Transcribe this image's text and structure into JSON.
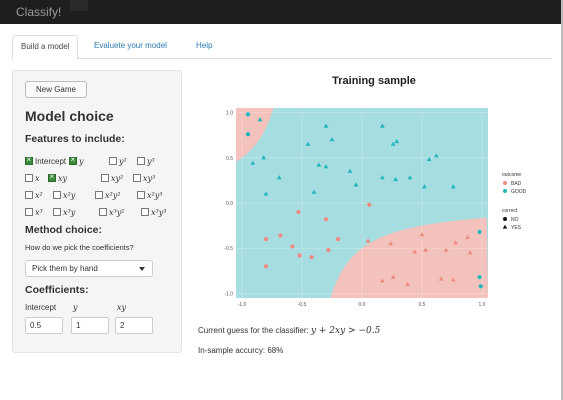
{
  "app": {
    "title": "Classify!"
  },
  "tabs": [
    "Build a model",
    "Evaluete your model",
    "Help"
  ],
  "sidebar": {
    "new_game": "New Game",
    "model_choice": "Model choice",
    "features_title": "Features to include:",
    "features": [
      {
        "label": "Intercept",
        "checked": true
      },
      {
        "label": "y",
        "checked": true
      },
      {
        "label": "y²",
        "checked": false
      },
      {
        "label": "y³",
        "checked": false
      },
      {
        "label": "x",
        "checked": false
      },
      {
        "label": "xy",
        "checked": true
      },
      {
        "label": "xy²",
        "checked": false
      },
      {
        "label": "xy³",
        "checked": false
      },
      {
        "label": "x²",
        "checked": false
      },
      {
        "label": "x²y",
        "checked": false
      },
      {
        "label": "x²y²",
        "checked": false
      },
      {
        "label": "x²y³",
        "checked": false
      },
      {
        "label": "x³",
        "checked": false
      },
      {
        "label": "x³y",
        "checked": false
      },
      {
        "label": "x³y²",
        "checked": false
      },
      {
        "label": "x³y³",
        "checked": false
      }
    ],
    "method_title": "Method choice:",
    "method_question": "How do we pick the coefficients?",
    "method_value": "Pick them by hand",
    "coef_title": "Coefficients:",
    "coefficients": [
      {
        "label": "Intercept",
        "value": "0.5"
      },
      {
        "label": "y",
        "value": "1"
      },
      {
        "label": "xy",
        "value": "2"
      }
    ]
  },
  "plot": {
    "title": "Training sample",
    "guess_prefix": "Current guess for the classifier:",
    "guess_formula": "y + 2xy > −0.5",
    "accuracy": "In-sample accurcy: 68%"
  },
  "chart_data": {
    "type": "scatter",
    "title": "Training sample",
    "xlim": [
      -1.0,
      1.0
    ],
    "ylim": [
      -1.0,
      1.0
    ],
    "xticks": [
      "-1.0",
      "-0.5",
      "0.0",
      "0.5",
      "1.0"
    ],
    "yticks": [
      "1.0",
      "0.5",
      "0.0",
      "-0.5",
      "-1.0"
    ],
    "colors": {
      "BAD": "#f08a80",
      "GOOD": "#22b6bf",
      "bad_region": "#f3c2bc",
      "good_region": "#a6dde1",
      "panel": "#e8e8e8"
    },
    "legend": {
      "outcome_title": "outcome",
      "outcome": [
        "BAD",
        "GOOD"
      ],
      "correct_title": "correct",
      "correct": [
        "NO",
        "YES"
      ]
    },
    "points": [
      {
        "x": -0.95,
        "y": 0.98,
        "outcome": "GOOD",
        "correct": "NO"
      },
      {
        "x": -0.95,
        "y": 0.76,
        "outcome": "GOOD",
        "correct": "NO"
      },
      {
        "x": -0.85,
        "y": 0.92,
        "outcome": "GOOD",
        "correct": "YES"
      },
      {
        "x": -0.82,
        "y": 0.5,
        "outcome": "GOOD",
        "correct": "YES"
      },
      {
        "x": -0.91,
        "y": 0.44,
        "outcome": "GOOD",
        "correct": "YES"
      },
      {
        "x": -0.8,
        "y": 0.1,
        "outcome": "GOOD",
        "correct": "YES"
      },
      {
        "x": -0.69,
        "y": 0.28,
        "outcome": "GOOD",
        "correct": "YES"
      },
      {
        "x": -0.45,
        "y": 0.65,
        "outcome": "GOOD",
        "correct": "YES"
      },
      {
        "x": -0.3,
        "y": 0.85,
        "outcome": "GOOD",
        "correct": "YES"
      },
      {
        "x": -0.25,
        "y": 0.7,
        "outcome": "GOOD",
        "correct": "YES"
      },
      {
        "x": -0.36,
        "y": 0.42,
        "outcome": "GOOD",
        "correct": "YES"
      },
      {
        "x": -0.3,
        "y": 0.4,
        "outcome": "GOOD",
        "correct": "YES"
      },
      {
        "x": -0.1,
        "y": 0.35,
        "outcome": "GOOD",
        "correct": "YES"
      },
      {
        "x": -0.4,
        "y": 0.12,
        "outcome": "GOOD",
        "correct": "YES"
      },
      {
        "x": -0.05,
        "y": 0.2,
        "outcome": "GOOD",
        "correct": "YES"
      },
      {
        "x": 0.17,
        "y": 0.85,
        "outcome": "GOOD",
        "correct": "YES"
      },
      {
        "x": 0.26,
        "y": 0.65,
        "outcome": "GOOD",
        "correct": "YES"
      },
      {
        "x": 0.29,
        "y": 0.68,
        "outcome": "GOOD",
        "correct": "YES"
      },
      {
        "x": 0.28,
        "y": 0.26,
        "outcome": "GOOD",
        "correct": "YES"
      },
      {
        "x": 0.4,
        "y": 0.28,
        "outcome": "GOOD",
        "correct": "YES"
      },
      {
        "x": 0.56,
        "y": 0.48,
        "outcome": "GOOD",
        "correct": "YES"
      },
      {
        "x": 0.62,
        "y": 0.52,
        "outcome": "GOOD",
        "correct": "YES"
      },
      {
        "x": 0.52,
        "y": 0.18,
        "outcome": "GOOD",
        "correct": "YES"
      },
      {
        "x": 0.76,
        "y": 0.18,
        "outcome": "GOOD",
        "correct": "YES"
      },
      {
        "x": 0.17,
        "y": 0.28,
        "outcome": "GOOD",
        "correct": "YES"
      },
      {
        "x": 0.98,
        "y": -0.32,
        "outcome": "GOOD",
        "correct": "NO"
      },
      {
        "x": 0.98,
        "y": -0.82,
        "outcome": "GOOD",
        "correct": "NO"
      },
      {
        "x": 0.99,
        "y": -0.92,
        "outcome": "GOOD",
        "correct": "NO"
      },
      {
        "x": -0.8,
        "y": -0.4,
        "outcome": "BAD",
        "correct": "NO"
      },
      {
        "x": -0.68,
        "y": -0.36,
        "outcome": "BAD",
        "correct": "NO"
      },
      {
        "x": -0.53,
        "y": -0.1,
        "outcome": "BAD",
        "correct": "NO"
      },
      {
        "x": -0.58,
        "y": -0.48,
        "outcome": "BAD",
        "correct": "NO"
      },
      {
        "x": -0.52,
        "y": -0.58,
        "outcome": "BAD",
        "correct": "NO"
      },
      {
        "x": -0.42,
        "y": -0.6,
        "outcome": "BAD",
        "correct": "NO"
      },
      {
        "x": -0.8,
        "y": -0.7,
        "outcome": "BAD",
        "correct": "NO"
      },
      {
        "x": -0.3,
        "y": -0.18,
        "outcome": "BAD",
        "correct": "NO"
      },
      {
        "x": -0.28,
        "y": -0.52,
        "outcome": "BAD",
        "correct": "NO"
      },
      {
        "x": -0.2,
        "y": -0.4,
        "outcome": "BAD",
        "correct": "NO"
      },
      {
        "x": 0.06,
        "y": -0.02,
        "outcome": "BAD",
        "correct": "NO"
      },
      {
        "x": 0.05,
        "y": -0.42,
        "outcome": "BAD",
        "correct": "YES"
      },
      {
        "x": 0.24,
        "y": -0.45,
        "outcome": "BAD",
        "correct": "YES"
      },
      {
        "x": 0.17,
        "y": -0.86,
        "outcome": "BAD",
        "correct": "YES"
      },
      {
        "x": 0.26,
        "y": -0.82,
        "outcome": "BAD",
        "correct": "YES"
      },
      {
        "x": 0.38,
        "y": -0.9,
        "outcome": "BAD",
        "correct": "YES"
      },
      {
        "x": 0.44,
        "y": -0.54,
        "outcome": "BAD",
        "correct": "YES"
      },
      {
        "x": 0.5,
        "y": -0.35,
        "outcome": "BAD",
        "correct": "YES"
      },
      {
        "x": 0.53,
        "y": -0.52,
        "outcome": "BAD",
        "correct": "YES"
      },
      {
        "x": 0.7,
        "y": -0.52,
        "outcome": "BAD",
        "correct": "YES"
      },
      {
        "x": 0.66,
        "y": -0.84,
        "outcome": "BAD",
        "correct": "YES"
      },
      {
        "x": 0.76,
        "y": -0.85,
        "outcome": "BAD",
        "correct": "YES"
      },
      {
        "x": 0.78,
        "y": -0.44,
        "outcome": "BAD",
        "correct": "YES"
      },
      {
        "x": 0.88,
        "y": -0.38,
        "outcome": "BAD",
        "correct": "YES"
      },
      {
        "x": 0.9,
        "y": -0.55,
        "outcome": "BAD",
        "correct": "YES"
      }
    ]
  }
}
